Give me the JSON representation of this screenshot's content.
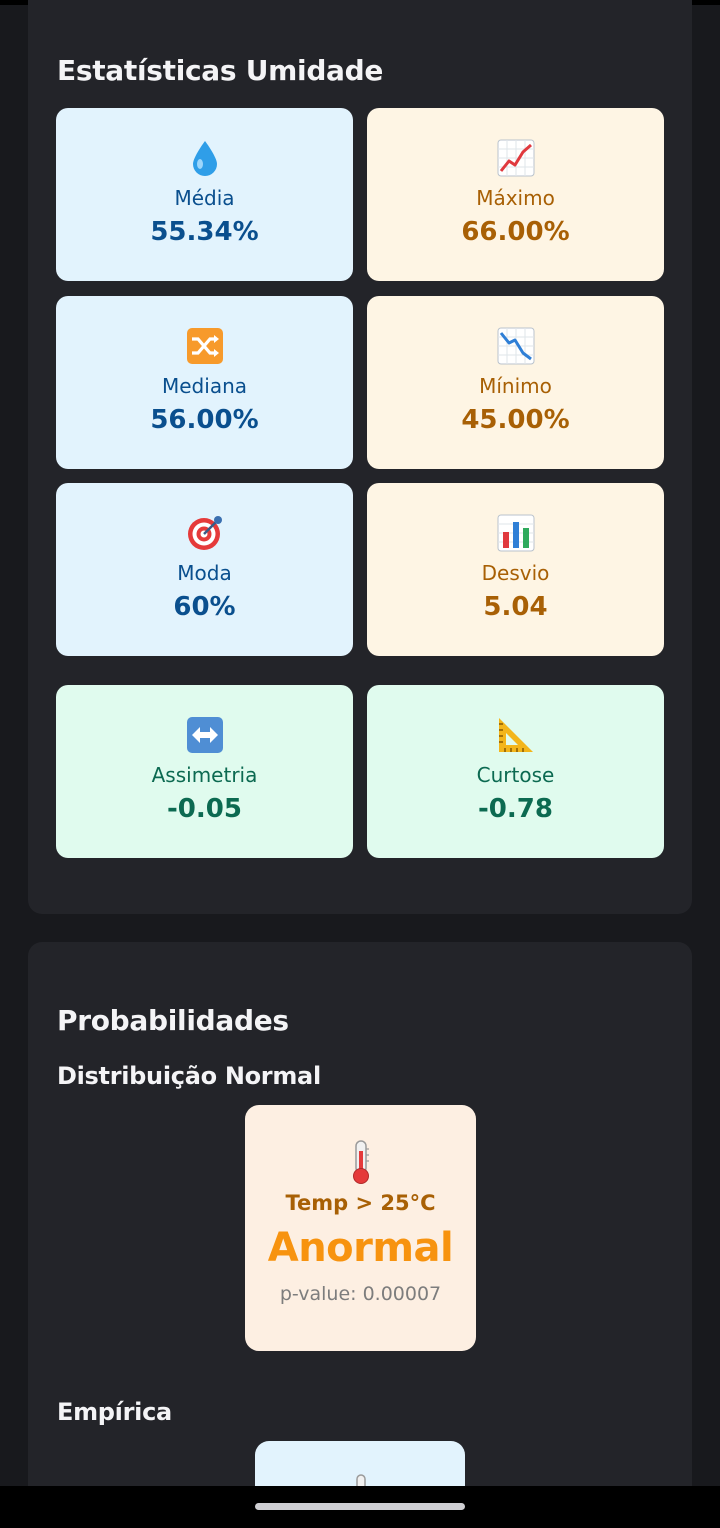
{
  "stats_section": {
    "title": "Estatísticas Umidade",
    "cards": [
      {
        "icon": "droplet-icon",
        "label": "Média",
        "value": "55.34%",
        "theme": "blue"
      },
      {
        "icon": "chart-increasing-icon",
        "label": "Máximo",
        "value": "66.00%",
        "theme": "cream"
      },
      {
        "icon": "shuffle-icon",
        "label": "Mediana",
        "value": "56.00%",
        "theme": "blue"
      },
      {
        "icon": "chart-decreasing-icon",
        "label": "Mínimo",
        "value": "45.00%",
        "theme": "cream"
      },
      {
        "icon": "target-icon",
        "label": "Moda",
        "value": "60%",
        "theme": "blue"
      },
      {
        "icon": "bar-chart-icon",
        "label": "Desvio",
        "value": "5.04",
        "theme": "cream"
      },
      {
        "icon": "left-right-arrow-icon",
        "label": "Assimetria",
        "value": "-0.05",
        "theme": "mint"
      },
      {
        "icon": "triangular-ruler-icon",
        "label": "Curtose",
        "value": "-0.78",
        "theme": "mint"
      }
    ]
  },
  "prob_section": {
    "title": "Probabilidades",
    "normal": {
      "subtitle": "Distribuição Normal",
      "card": {
        "icon": "thermometer-icon",
        "title": "Temp > 25°C",
        "result": "Anormal",
        "pvalue": "p-value: 0.00007"
      }
    },
    "empirical": {
      "subtitle": "Empírica",
      "card_icon": "thermometer-icon"
    }
  },
  "colors": {
    "background": "#18191d",
    "panel": "#232429",
    "blue_card": "#e2f3fd",
    "blue_text": "#0a4f8e",
    "cream_card": "#fef5e4",
    "cream_text": "#a86005",
    "mint_card": "#e0fbee",
    "mint_text": "#0c6a51",
    "anormal_orange": "#f7930f"
  }
}
